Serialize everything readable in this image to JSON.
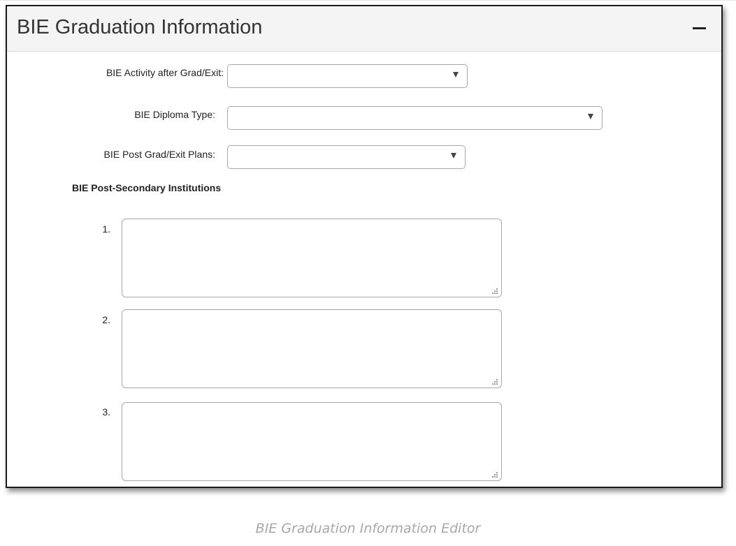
{
  "panel": {
    "title": "BIE Graduation Information",
    "collapse_symbol": "−"
  },
  "fields": {
    "activity": {
      "label": "BIE Activity after Grad/Exit:",
      "value": ""
    },
    "diploma": {
      "label": "BIE Diploma Type:",
      "value": ""
    },
    "plans": {
      "label": "BIE Post Grad/Exit Plans:",
      "value": ""
    }
  },
  "institutions": {
    "heading": "BIE Post-Secondary Institutions",
    "items": [
      {
        "number": "1.",
        "value": ""
      },
      {
        "number": "2.",
        "value": ""
      },
      {
        "number": "3.",
        "value": ""
      }
    ]
  },
  "caption": "BIE Graduation Information Editor",
  "icons": {
    "collapse": "minus-icon",
    "select_arrow": "caret-down-icon",
    "resize": "resize-grip-icon"
  },
  "colors": {
    "header_bg": "#f4f4f4",
    "border": "#a8a8a8",
    "caption": "#a8a8a8"
  }
}
